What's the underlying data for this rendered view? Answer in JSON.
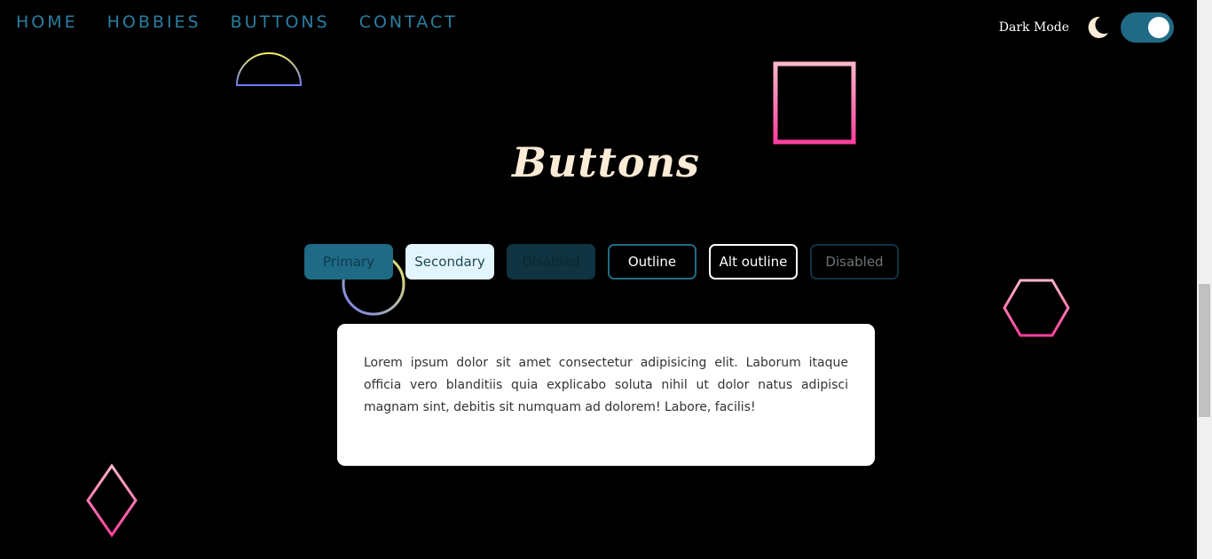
{
  "nav": {
    "items": [
      {
        "label": "HOME"
      },
      {
        "label": "HOBBIES"
      },
      {
        "label": "BUTTONS"
      },
      {
        "label": "CONTACT"
      }
    ]
  },
  "dark_mode": {
    "label": "Dark Mode",
    "icon": "moon-icon",
    "enabled": true
  },
  "page": {
    "title": "Buttons"
  },
  "buttons": [
    {
      "label": "Primary",
      "variant": "primary"
    },
    {
      "label": "Secondary",
      "variant": "secondary"
    },
    {
      "label": "Disabled",
      "variant": "disabled"
    },
    {
      "label": "Outline",
      "variant": "outline"
    },
    {
      "label": "Alt outline",
      "variant": "alt-outline"
    },
    {
      "label": "Disabled",
      "variant": "outline-disabled"
    }
  ],
  "card": {
    "text": "Lorem ipsum dolor sit amet consectetur adipisicing elit. Laborum itaque officia vero blanditiis quia explicabo soluta nihil ut dolor natus adipisci magnam sint, debitis sit numquam ad dolorem! Labore, facilis!"
  },
  "colors": {
    "accent": "#216a86",
    "nav_text": "#2a7ea1",
    "title": "#fcebd6",
    "pink": "#ff4fa0",
    "background": "#000000"
  }
}
